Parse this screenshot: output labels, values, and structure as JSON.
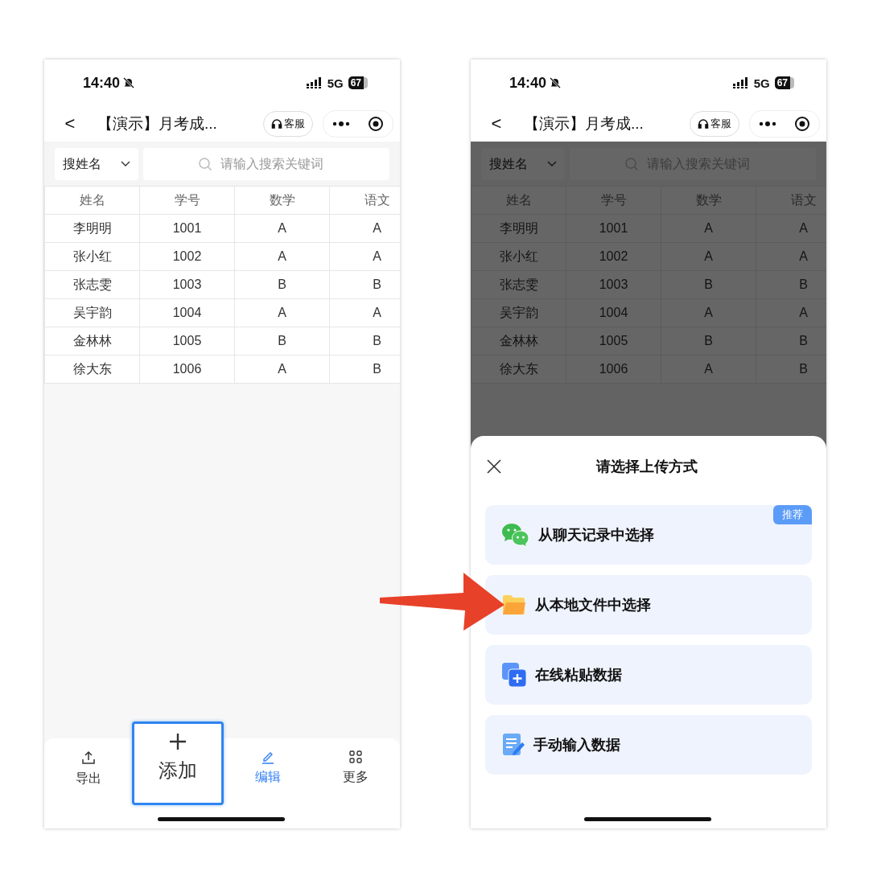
{
  "phones": [
    {
      "status_bar": {
        "time": "14:40",
        "network": "5G",
        "battery": "67"
      },
      "nav": {
        "back": "<",
        "title": "【演示】月考成...",
        "service": "客服"
      },
      "search": {
        "field_select": "搜姓名",
        "placeholder": "请输入搜索关键词"
      },
      "table": {
        "columns": [
          "姓名",
          "学号",
          "数学",
          "语文"
        ],
        "rows": [
          [
            "李明明",
            "1001",
            "A",
            "A"
          ],
          [
            "张小红",
            "1002",
            "A",
            "A"
          ],
          [
            "张志雯",
            "1003",
            "B",
            "B"
          ],
          [
            "吴宇韵",
            "1004",
            "A",
            "A"
          ],
          [
            "金林林",
            "1005",
            "B",
            "B"
          ],
          [
            "徐大东",
            "1006",
            "A",
            "B"
          ]
        ]
      },
      "toolbar": [
        {
          "kind": "export",
          "label": "导出",
          "selected": false,
          "highlighted": false
        },
        {
          "kind": "add",
          "label": "添加",
          "selected": false,
          "highlighted": true
        },
        {
          "kind": "edit",
          "label": "编辑",
          "selected": true,
          "highlighted": false
        },
        {
          "kind": "more",
          "label": "更多",
          "selected": false,
          "highlighted": false
        }
      ]
    },
    {
      "status_bar": {
        "time": "14:40",
        "network": "5G",
        "battery": "67"
      },
      "nav": {
        "back": "<",
        "title": "【演示】月考成...",
        "service": "客服"
      },
      "search": {
        "field_select": "搜姓名",
        "placeholder": "请输入搜索关键词"
      },
      "table": {
        "columns": [
          "姓名",
          "学号",
          "数学",
          "语文"
        ],
        "rows": [
          [
            "李明明",
            "1001",
            "A",
            "A"
          ],
          [
            "张小红",
            "1002",
            "A",
            "A"
          ],
          [
            "张志雯",
            "1003",
            "B",
            "B"
          ],
          [
            "吴宇韵",
            "1004",
            "A",
            "A"
          ],
          [
            "金林林",
            "1005",
            "B",
            "B"
          ],
          [
            "徐大东",
            "1006",
            "A",
            "B"
          ]
        ]
      },
      "sheet": {
        "title": "请选择上传方式",
        "options": [
          {
            "kind": "chat",
            "label": "从聊天记录中选择",
            "badge": "推荐"
          },
          {
            "kind": "folder",
            "label": "从本地文件中选择"
          },
          {
            "kind": "paste",
            "label": "在线粘贴数据"
          },
          {
            "kind": "manual",
            "label": "手动输入数据"
          }
        ]
      }
    }
  ]
}
